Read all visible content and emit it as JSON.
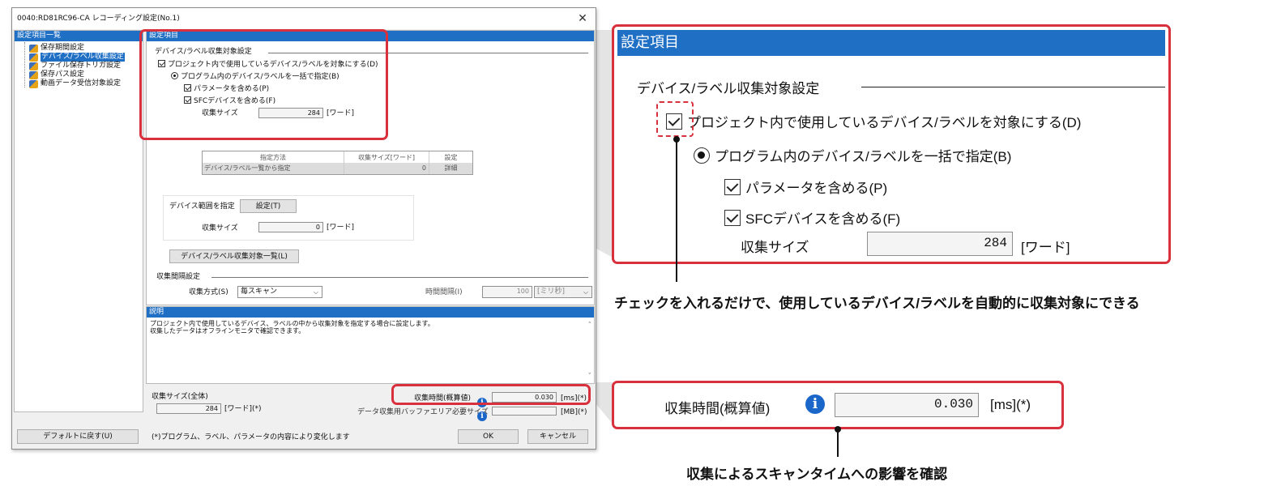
{
  "dialog": {
    "title": "0040:RD81RC96-CA レコーディング設定(No.1)",
    "close_glyph": "✕"
  },
  "tree": {
    "header": "設定項目一覧",
    "items": [
      {
        "label": "保存期間設定"
      },
      {
        "label": "デバイス/ラベル収集設定",
        "selected": true
      },
      {
        "label": "ファイル保存トリガ設定"
      },
      {
        "label": "保存パス設定"
      },
      {
        "label": "動画データ受信対象設定"
      }
    ]
  },
  "settings": {
    "header": "設定項目",
    "group_title": "デバイス/ラベル収集対象設定",
    "use_project_devices_label": "プロジェクト内で使用しているデバイス/ラベルを対象にする(D)",
    "use_project_devices_checked": true,
    "bulk_label": "プログラム内のデバイス/ラベルを一括で指定(B)",
    "include_params_label": "パラメータを含める(P)",
    "include_sfc_label": "SFCデバイスを含める(F)",
    "collect_size_label": "収集サイズ",
    "collect_size_value": "284",
    "unit_word": "[ワード]",
    "table": {
      "headers": [
        "指定方法",
        "収集サイズ[ワード]",
        "設定"
      ],
      "row": [
        "デバイス/ラベル一覧から指定",
        "0",
        "詳細"
      ]
    },
    "range_label": "デバイス範囲を指定",
    "range_button": "設定(T)",
    "range_size_label": "収集サイズ",
    "range_size_value": "0",
    "range_unit": "[ワード]",
    "list_button": "デバイス/ラベル収集対象一覧(L)",
    "interval_group": "収集間隔設定",
    "method_label": "収集方式(S)",
    "method_value": "毎スキャン",
    "interval_label": "時間間隔(I)",
    "interval_value": "100",
    "interval_unit": "[ミリ秒]"
  },
  "description": {
    "header": "説明",
    "line1": "プロジェクト内で使用しているデバイス、ラベルの中から収集対象を指定する場合に設定します。",
    "line2": "収集したデータはオフラインモニタで確認できます。"
  },
  "bottom": {
    "total_size_label": "収集サイズ(全体)",
    "total_size_value": "284",
    "total_size_unit": "[ワード](*)",
    "time_label": "収集時間(概算値)",
    "time_value": "0.030",
    "time_unit": "[ms](*)",
    "buffer_label": "データ収集用バッファエリア必要サイズ",
    "buffer_unit": "[MB](*)",
    "note": "(*)プログラム、ラベル、パラメータの内容により変化します",
    "default_button": "デフォルトに戻す(U)",
    "ok_button": "OK",
    "cancel_button": "キャンセル",
    "info_glyph": "i"
  },
  "zoom": {
    "header": "設定項目",
    "group_title": "デバイス/ラベル収集対象設定",
    "use_project_devices_label": "プロジェクト内で使用しているデバイス/ラベルを対象にする(D)",
    "bulk_label": "プログラム内のデバイス/ラベルを一括で指定(B)",
    "include_params_label": "パラメータを含める(P)",
    "include_sfc_label": "SFCデバイスを含める(F)",
    "collect_size_label": "収集サイズ",
    "collect_size_value": "284",
    "unit_word": "[ワード]",
    "time_label": "収集時間(概算値)",
    "time_value": "0.030",
    "time_unit": "[ms](*)"
  },
  "callouts": {
    "checkbox_caption": "チェックを入れるだけで、使用しているデバイス/ラベルを自動的に収集対象にできる",
    "time_caption": "収集によるスキャンタイムへの影響を確認"
  },
  "colors": {
    "accent_blue": "#1f6fc5",
    "highlight_red": "#d8303c"
  }
}
